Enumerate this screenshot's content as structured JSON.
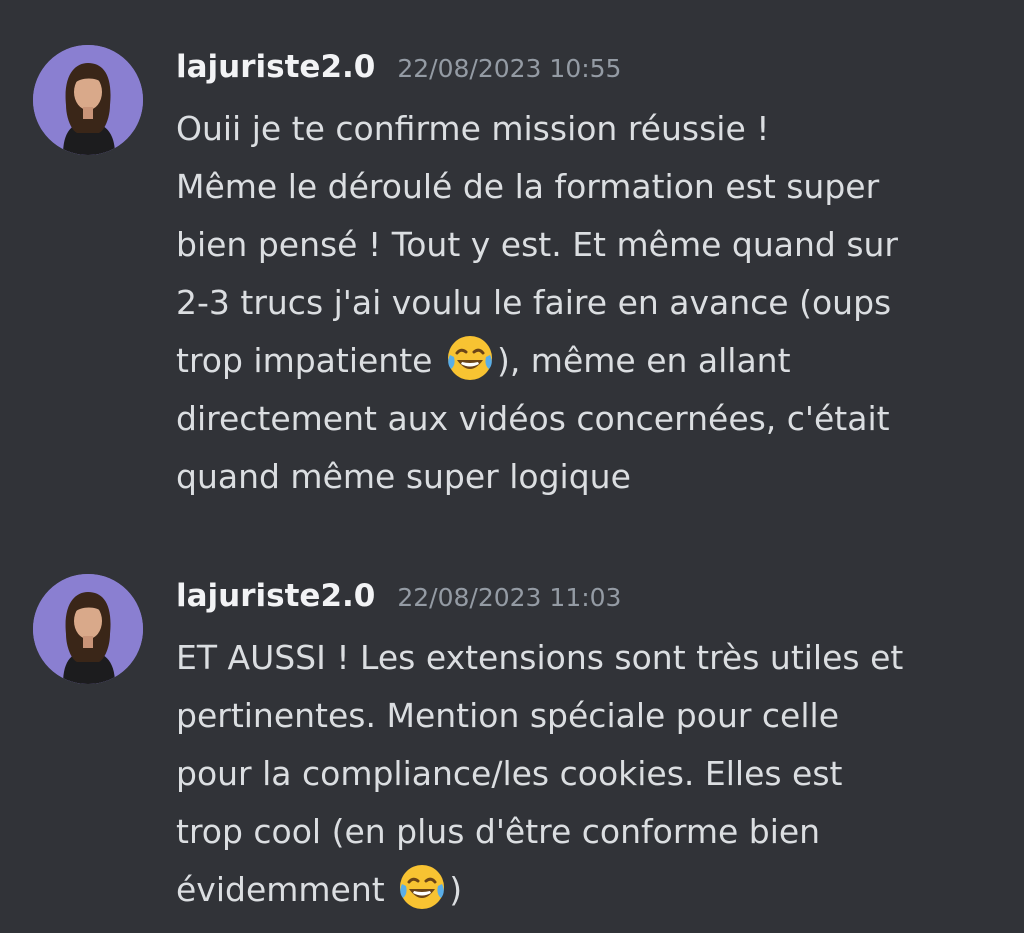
{
  "messages": [
    {
      "username": "lajuriste2.0",
      "timestamp": "22/08/2023 10:55",
      "lines": [
        {
          "text": "Ouii je te confirme mission réussie !"
        },
        {
          "text": "Même le déroulé de la formation est super"
        },
        {
          "text": "bien pensé ! Tout y est. Et même quand sur"
        },
        {
          "text": "2-3 trucs j'ai voulu le faire en avance (oups"
        },
        {
          "before": "trop impatiente ",
          "emoji": "face-with-tears-of-joy",
          "after": "), même en allant"
        },
        {
          "text": "directement aux vidéos concernées, c'était"
        },
        {
          "text": "quand même super logique"
        }
      ]
    },
    {
      "username": "lajuriste2.0",
      "timestamp": "22/08/2023 11:03",
      "lines": [
        {
          "text": "ET AUSSI ! Les extensions sont très utiles et"
        },
        {
          "text": "pertinentes. Mention spéciale pour celle"
        },
        {
          "text": "pour la compliance/les cookies. Elles est"
        },
        {
          "text": "trop cool (en plus d'être conforme bien"
        },
        {
          "before": "évidemment ",
          "emoji": "face-with-tears-of-joy",
          "after": ")"
        }
      ]
    }
  ],
  "colors": {
    "background": "#313338",
    "username": "#f2f3f5",
    "timestamp": "#949ba4",
    "text": "#dbdee1",
    "avatar_bg": "#8a7fd1"
  }
}
